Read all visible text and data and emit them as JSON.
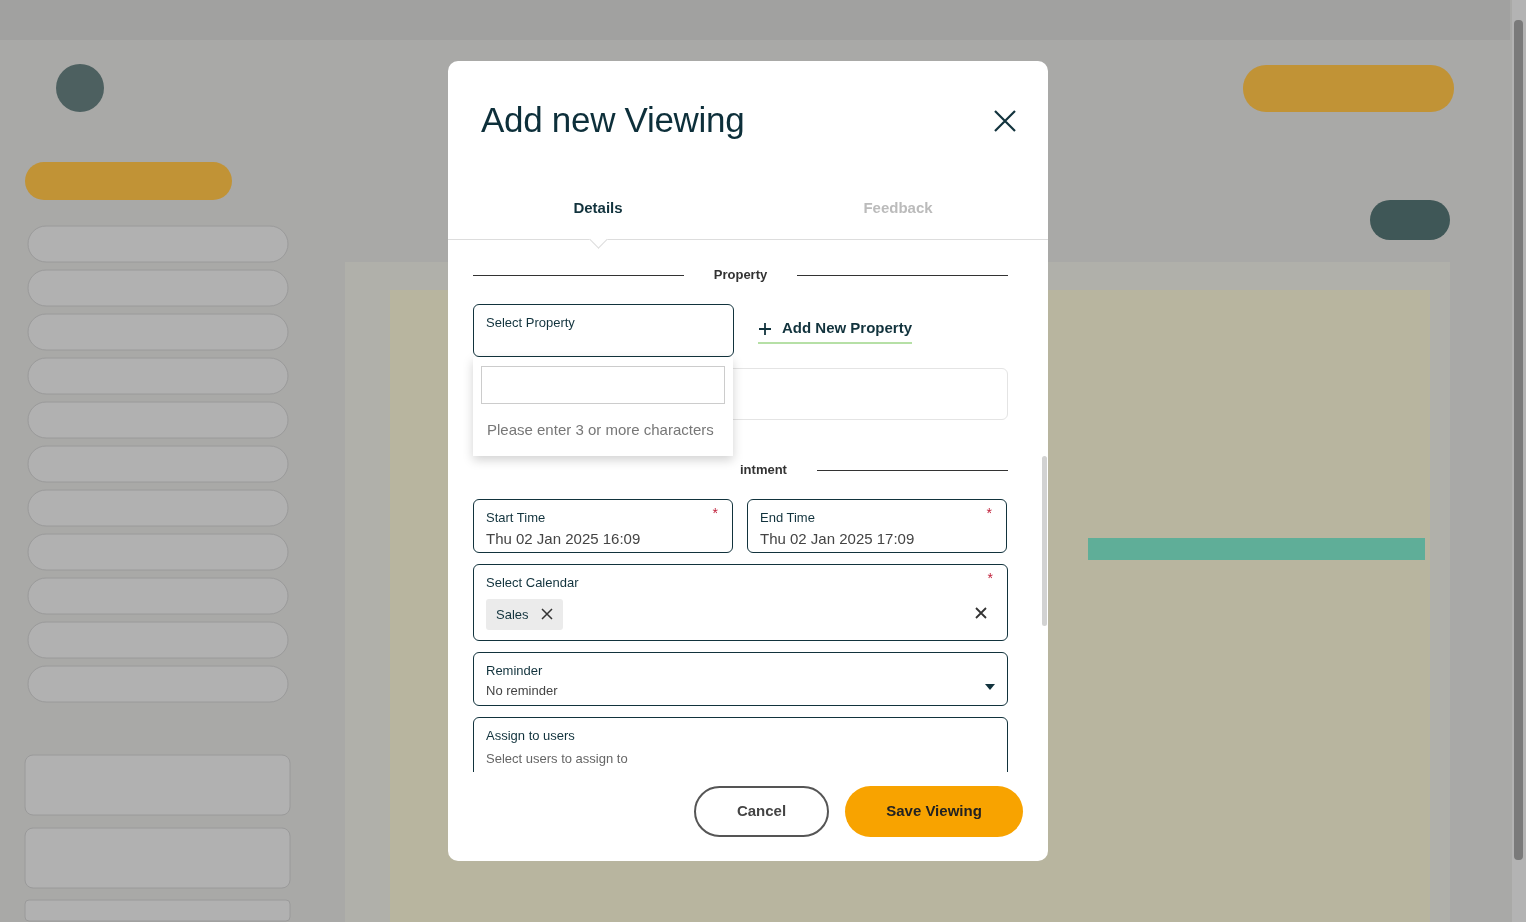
{
  "dialog": {
    "title": "Add new Viewing",
    "tabs": [
      {
        "label": "Details",
        "selected": true
      },
      {
        "label": "Feedback",
        "selected": false
      }
    ],
    "property_section": {
      "heading": "Property",
      "select": {
        "label": "Select Property"
      },
      "add_link": "Add New Property",
      "dropdown": {
        "message": "Please enter 3 or more characters"
      }
    },
    "appointment_section": {
      "heading": "intment",
      "fields": [
        {
          "kind": "datetime",
          "label": "Start Time",
          "value": "Thu 02 Jan 2025 16:09",
          "required_mark": "*"
        },
        {
          "kind": "datetime",
          "label": "End Time",
          "value": "Thu 02 Jan 2025 17:09",
          "required_mark": "*"
        },
        {
          "kind": "tags",
          "label": "Select Calendar",
          "required_mark": "*",
          "tags": [
            "Sales"
          ]
        },
        {
          "kind": "select",
          "label": "Reminder",
          "value": "No reminder"
        },
        {
          "kind": "multiselect",
          "label": "Assign to users",
          "placeholder": "Select users to assign to"
        }
      ]
    },
    "buttons": [
      {
        "label": "Cancel",
        "kind": "secondary"
      },
      {
        "label": "Save Viewing",
        "kind": "primary"
      }
    ]
  }
}
